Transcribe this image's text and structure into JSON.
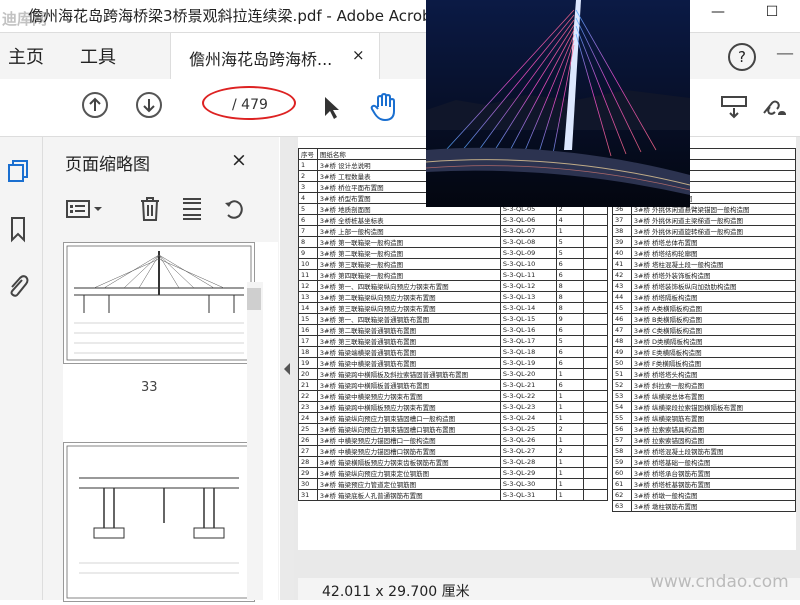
{
  "window": {
    "title": "儋州海花岛跨海桥梁3桥景观斜拉连续梁.pdf - Adobe Acrob",
    "watermark": "迪库网",
    "minimize": "—",
    "maximize": "☐",
    "close": "✕"
  },
  "menu": {
    "home": "主页",
    "tools": "工具",
    "doc_tab": "儋州海花岛跨海桥...",
    "doc_tab_close": "×",
    "help": "?",
    "more": "—"
  },
  "toolbar": {
    "page_current": "",
    "page_total": "/ 479"
  },
  "panel": {
    "title": "页面缩略图",
    "close": "×",
    "thumb1_number": "33"
  },
  "index_table": {
    "header": [
      "序号",
      "图纸名称",
      "",
      "",
      "",
      "图纸名称"
    ],
    "left_rows": [
      [
        "1",
        "3#桥 设计总说明",
        "",
        "",
        ""
      ],
      [
        "2",
        "3#桥 工程数量表",
        "",
        "",
        ""
      ],
      [
        "3",
        "3#桥 桥位平面布置图",
        "",
        "",
        ""
      ],
      [
        "4",
        "3#桥 桥型布置图",
        "S-3-QL-04",
        "7",
        ""
      ],
      [
        "5",
        "3#桥 地质剖面图",
        "S-3-QL-05",
        "2",
        ""
      ],
      [
        "6",
        "3#桥 全桥桩基坐标表",
        "S-3-QL-06",
        "4",
        ""
      ],
      [
        "7",
        "3#桥 上部一般构造图",
        "S-3-QL-07",
        "1",
        ""
      ],
      [
        "8",
        "3#桥 第一联箱梁一般构造图",
        "S-3-QL-08",
        "5",
        ""
      ],
      [
        "9",
        "3#桥 第二联箱梁一般构造图",
        "S-3-QL-09",
        "5",
        ""
      ],
      [
        "10",
        "3#桥 第三联箱梁一般构造图",
        "S-3-QL-10",
        "6",
        ""
      ],
      [
        "11",
        "3#桥 第四联箱梁一般构造图",
        "S-3-QL-11",
        "6",
        ""
      ],
      [
        "12",
        "3#桥 第一、四联箱梁纵向预应力钢束布置图",
        "S-3-QL-12",
        "8",
        ""
      ],
      [
        "13",
        "3#桥 第二联箱梁纵向预应力钢束布置图",
        "S-3-QL-13",
        "8",
        ""
      ],
      [
        "14",
        "3#桥 第三联箱梁纵向预应力钢束布置图",
        "S-3-QL-14",
        "8",
        ""
      ],
      [
        "15",
        "3#桥 第一、四联箱梁普通钢筋布置图",
        "S-3-QL-15",
        "9",
        ""
      ],
      [
        "16",
        "3#桥 第二联箱梁普通钢筋布置图",
        "S-3-QL-16",
        "6",
        ""
      ],
      [
        "17",
        "3#桥 第三联箱梁普通钢筋布置图",
        "S-3-QL-17",
        "5",
        ""
      ],
      [
        "18",
        "3#桥 箱梁端横梁普通钢筋布置图",
        "S-3-QL-18",
        "6",
        ""
      ],
      [
        "19",
        "3#桥 箱梁中横梁普通钢筋布置图",
        "S-3-QL-19",
        "6",
        ""
      ],
      [
        "20",
        "3#桥 箱梁跨中横隔板及斜拉索锚固普通钢筋布置图",
        "S-3-QL-20",
        "1",
        ""
      ],
      [
        "21",
        "3#桥 箱梁跨中横隔板普通钢筋布置图",
        "S-3-QL-21",
        "6",
        ""
      ],
      [
        "22",
        "3#桥 箱梁中横梁预应力钢束布置图",
        "S-3-QL-22",
        "1",
        ""
      ],
      [
        "23",
        "3#桥 箱梁跨中横隔板预应力钢束布置图",
        "S-3-QL-23",
        "1",
        ""
      ],
      [
        "24",
        "3#桥 箱梁纵向预应力钢束锚固槽口一般构造图",
        "S-3-QL-24",
        "1",
        ""
      ],
      [
        "25",
        "3#桥 箱梁纵向预应力钢束锚固槽口钢筋布置图",
        "S-3-QL-25",
        "2",
        ""
      ],
      [
        "26",
        "3#桥 中横梁预应力锚固槽口一般构造图",
        "S-3-QL-26",
        "1",
        ""
      ],
      [
        "27",
        "3#桥 中横梁预应力锚固槽口钢筋布置图",
        "S-3-QL-27",
        "2",
        ""
      ],
      [
        "28",
        "3#桥 箱梁横隔板预应力钢束齿板钢筋布置图",
        "S-3-QL-28",
        "1",
        ""
      ],
      [
        "29",
        "3#桥 箱梁纵向预应力钢束定位钢筋图",
        "S-3-QL-29",
        "1",
        ""
      ],
      [
        "30",
        "3#桥 箱梁预应力管道定位钢筋图",
        "S-3-QL-30",
        "1",
        ""
      ],
      [
        "31",
        "3#桥 箱梁底板人孔普通钢筋布置图",
        "S-3-QL-31",
        "1",
        ""
      ]
    ],
    "right_rows": [
      [
        "",
        "道总体布置图"
      ],
      [
        "",
        "道主梁一般构造图"
      ],
      [
        "",
        "道平竖曲线示意图"
      ],
      [
        "",
        "道悬臂梁一般构造图"
      ],
      [
        "36",
        "3#桥 外挑休闲道悬臂梁锚固一般构造图"
      ],
      [
        "37",
        "3#桥 外挑休闲道主梁梯道一般构造图"
      ],
      [
        "38",
        "3#桥 外挑休闲道旋转梯道一般构造图"
      ],
      [
        "39",
        "3#桥 桥塔总体布置图"
      ],
      [
        "40",
        "3#桥 桥塔结构轮廓图"
      ],
      [
        "41",
        "3#桥 塔柱混凝土段一般构造图"
      ],
      [
        "42",
        "3#桥 桥塔外装饰板构造图"
      ],
      [
        "43",
        "3#桥 桥塔装饰板纵向加劲肋构造图"
      ],
      [
        "44",
        "3#桥 桥塔隔板构造图"
      ],
      [
        "45",
        "3#桥 A类横隔板构造图"
      ],
      [
        "46",
        "3#桥 B类横隔板构造图"
      ],
      [
        "47",
        "3#桥 C类横隔板构造图"
      ],
      [
        "48",
        "3#桥 D类横隔板构造图"
      ],
      [
        "49",
        "3#桥 E类横隔板构造图"
      ],
      [
        "50",
        "3#桥 F类横隔板构造图"
      ],
      [
        "51",
        "3#桥 桥塔塔头构造图"
      ],
      [
        "52",
        "3#桥 斜拉索一般构造图"
      ],
      [
        "53",
        "3#桥 纵横梁总体布置图"
      ],
      [
        "54",
        "3#桥 纵横梁段拉索锚固横隔板布置图"
      ],
      [
        "55",
        "3#桥 纵横梁钢筋布置图"
      ],
      [
        "56",
        "3#桥 拉索索锚具构造图"
      ],
      [
        "57",
        "3#桥 拉索索锚固构造图"
      ],
      [
        "58",
        "3#桥 桥塔混凝土段钢筋布置图"
      ],
      [
        "59",
        "3#桥 桥塔基础一般构造图"
      ],
      [
        "60",
        "3#桥 桥塔承台钢筋布置图"
      ],
      [
        "61",
        "3#桥 桥塔桩基钢筋布置图"
      ],
      [
        "62",
        "3#桥 桥墩一般构造图"
      ],
      [
        "63",
        "3#桥 墩柱钢筋布置图"
      ]
    ]
  },
  "status": {
    "dimensions": "42.011 x 29.700 厘米",
    "watermark": "www.cndao.com"
  }
}
